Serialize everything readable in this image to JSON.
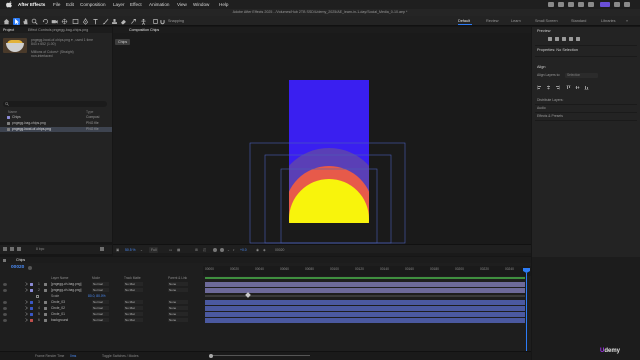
{
  "menubar": {
    "app": "After Effects",
    "items": [
      "File",
      "Edit",
      "Composition",
      "Layer",
      "Effect",
      "Animation",
      "View",
      "Window",
      "Help"
    ]
  },
  "titlebar": {
    "title": "Adobe After Effects 2025 - /Volumes/Hub 2TB SSD/Udemy_2025/AE_learn-in-1-day/Social_Media_0-10.aep *"
  },
  "toolbar": {
    "snapping_label": "Snapping",
    "workspaces": [
      "Default",
      "Review",
      "Learn",
      "Small Screen",
      "Standard",
      "Libraries"
    ],
    "active_workspace": "Default"
  },
  "project_panel": {
    "tabs": [
      "Project",
      "Effect Controls pngegg-bag-chips.png"
    ],
    "selected_file": "pngegg-bowl-of-chips.png ▾ , used 1 time",
    "dimensions": "843 x 652 (1.00)",
    "colors": "Millions of Colors+ (Straight)",
    "interlace": "non-interlaced",
    "col_name": "Name",
    "col_type": "Type",
    "items": [
      {
        "name": "Chips",
        "type": "Composi",
        "color": "#8d8cd8",
        "selected": false
      },
      {
        "name": "pngegg-bag-chips.png",
        "type": "PNG file",
        "color": "#7f7f7f",
        "selected": false
      },
      {
        "name": "pngegg-bowl-of-chips.png",
        "type": "PNG file",
        "color": "#7f7f7f",
        "selected": true
      }
    ],
    "bpc": "8 bpc"
  },
  "composition": {
    "tab": "Composition Chips",
    "comp_name": "Chips",
    "zoom": "50.5 %",
    "resolution": "Full",
    "exposure": "+0.0",
    "timecode": "00020",
    "shapes": {
      "background": "#3a1ff0",
      "circle_03": "#5a3fb6",
      "circle_02": "#e75a4a",
      "circle_01": "#f8f40c"
    }
  },
  "right_panel": {
    "preview_title": "Preview",
    "properties_title": "Properties: No Selection",
    "align_title": "Align",
    "align_layers_to": "Align Layers to:",
    "align_target": "Selection",
    "distribute": "Distribute Layers:",
    "audio": "Audio",
    "effects": "Effects & Presets"
  },
  "timeline": {
    "tab": "Chips",
    "timecode": "00020",
    "col_layer_name": "Layer Name",
    "col_mode": "Mode",
    "col_trkmat": "Track Matte",
    "col_parent": "Parent & Link",
    "ruler": [
      "00000",
      "00020",
      "00040",
      "00060",
      "00080",
      "00100",
      "00120",
      "00140",
      "00160",
      "00180",
      "00200",
      "00220",
      "00240"
    ],
    "layers": [
      {
        "num": "1",
        "name": "[pngegg-ch-bag.png]",
        "mode": "Normal",
        "trk": "No Mat",
        "parent": "None",
        "color": "#8d8cd8"
      },
      {
        "num": "2",
        "name": "[pngegg-ch-bag.png]",
        "mode": "Normal",
        "trk": "No Mat",
        "parent": "None",
        "color": "#8d8cd8"
      },
      {
        "num": "3",
        "name": "Circle_03",
        "mode": "Normal",
        "trk": "No Mat",
        "parent": "None",
        "color": "#3a57c8"
      },
      {
        "num": "4",
        "name": "Circle_02",
        "mode": "Normal",
        "trk": "No Mat",
        "parent": "None",
        "color": "#3a57c8"
      },
      {
        "num": "5",
        "name": "Circle_01",
        "mode": "Normal",
        "trk": "No Mat",
        "parent": "None",
        "color": "#3a57c8"
      },
      {
        "num": "6",
        "name": "background",
        "mode": "Normal",
        "trk": "No Mat",
        "parent": "None",
        "color": "#c0504d"
      }
    ],
    "scale_label": "Scale",
    "scale_value": "80.0, 80.0%",
    "frame_render_time": "Frame Render Time",
    "frame_render_value": "0ms",
    "toggle_label": "Toggle Switches / Modes"
  },
  "watermark": {
    "u": "U",
    "rest": "demy"
  }
}
